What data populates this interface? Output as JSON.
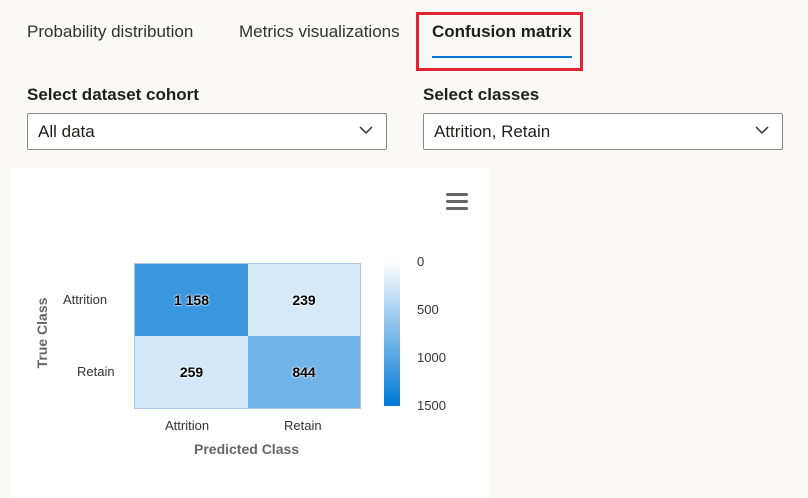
{
  "tabs": [
    {
      "label": "Probability distribution",
      "selected": false
    },
    {
      "label": "Metrics visualizations",
      "selected": false
    },
    {
      "label": "Confusion matrix",
      "selected": true
    }
  ],
  "colors": {
    "accent": "#0078d4",
    "highlight": "#e3232f"
  },
  "cohort": {
    "label": "Select dataset cohort",
    "value": "All data"
  },
  "classes": {
    "label": "Select classes",
    "value": "Attrition, Retain"
  },
  "chart_data": {
    "type": "heatmap",
    "x_categories": [
      "Attrition",
      "Retain"
    ],
    "y_categories": [
      "Attrition",
      "Retain"
    ],
    "values": [
      [
        1158,
        239
      ],
      [
        259,
        844
      ]
    ],
    "display_values": [
      [
        "1 158",
        "239"
      ],
      [
        "259",
        "844"
      ]
    ],
    "xlabel": "Predicted Class",
    "ylabel": "True Class",
    "colorbar_ticks": [
      "0",
      "500",
      "1000",
      "1500"
    ],
    "colorbar_range": [
      0,
      1500
    ]
  }
}
